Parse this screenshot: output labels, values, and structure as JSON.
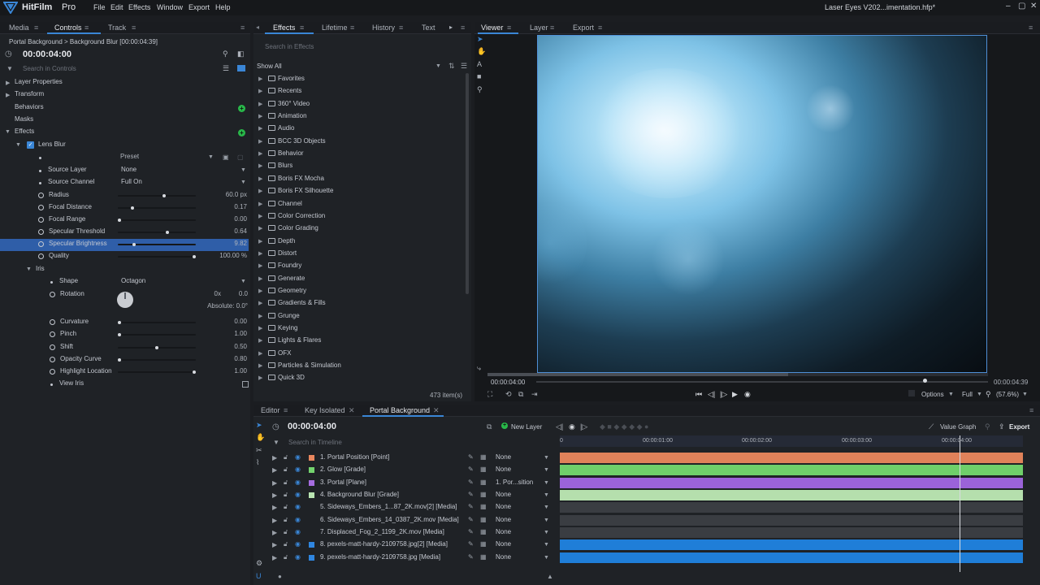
{
  "app": {
    "name": "HitFilm",
    "edition": "Pro",
    "window_title": "Laser Eyes V202...imentation.hfp*"
  },
  "menu": [
    "File",
    "Edit",
    "Effects",
    "Window",
    "Export",
    "Help"
  ],
  "left_tabs": [
    "Media",
    "Controls",
    "Track"
  ],
  "controls": {
    "breadcrumb": "Portal Background > Background Blur [00:00:04:39]",
    "time": "00:00:04:00",
    "search_placeholder": "Search in Controls",
    "sections": [
      "Layer Properties",
      "Transform",
      "Behaviors",
      "Masks",
      "Effects"
    ],
    "effect_name": "Lens Blur",
    "preset_label": "Preset",
    "source_layer": {
      "label": "Source Layer",
      "value": "None"
    },
    "source_channel": {
      "label": "Source Channel",
      "value": "Full On"
    },
    "params": [
      {
        "label": "Radius",
        "value": "60.0 px",
        "pos": 0.6
      },
      {
        "label": "Focal Distance",
        "value": "0.17",
        "pos": 0.17
      },
      {
        "label": "Focal Range",
        "value": "0.00",
        "pos": 0.0
      },
      {
        "label": "Specular Threshold",
        "value": "0.64",
        "pos": 0.64
      },
      {
        "label": "Specular Brightness",
        "value": "9.82",
        "pos": 0.2
      },
      {
        "label": "Quality",
        "value": "100.00 %",
        "pos": 1.0
      }
    ],
    "iris": {
      "label": "Iris",
      "shape": {
        "label": "Shape",
        "value": "Octagon"
      },
      "rotation": {
        "label": "Rotation",
        "turns": "0x",
        "deg": "0.0",
        "absolute": "Absolute: 0.0°"
      },
      "params": [
        {
          "label": "Curvature",
          "value": "0.00",
          "pos": 0.0
        },
        {
          "label": "Pinch",
          "value": "1.00",
          "pos": 0.0
        },
        {
          "label": "Shift",
          "value": "0.50",
          "pos": 0.5
        },
        {
          "label": "Opacity Curve",
          "value": "0.80",
          "pos": 0.0
        },
        {
          "label": "Highlight Location",
          "value": "1.00",
          "pos": 1.0
        }
      ],
      "view_iris": "View Iris"
    }
  },
  "effects_panel": {
    "tabs": [
      "Effects",
      "Lifetime",
      "History",
      "Text"
    ],
    "search_placeholder": "Search in Effects",
    "filter": "Show All",
    "folders": [
      "Favorites",
      "Recents",
      "360° Video",
      "Animation",
      "Audio",
      "BCC 3D Objects",
      "Behavior",
      "Blurs",
      "Boris FX Mocha",
      "Boris FX Silhouette",
      "Channel",
      "Color Correction",
      "Color Grading",
      "Depth",
      "Distort",
      "Foundry",
      "Generate",
      "Geometry",
      "Gradients & Fills",
      "Grunge",
      "Keying",
      "Lights & Flares",
      "OFX",
      "Particles & Simulation",
      "Quick 3D"
    ],
    "count": "473 item(s)"
  },
  "viewer": {
    "tabs": [
      "Viewer",
      "Layer",
      "Export"
    ],
    "time_start": "00:00:04:00",
    "time_end": "00:00:04:39",
    "progress": 0.6,
    "options_label": "Options",
    "quality": "Full",
    "zoom": "(57.6%)"
  },
  "timeline": {
    "tabs": [
      "Editor",
      "Key Isolated",
      "Portal Background"
    ],
    "time": "00:00:04:00",
    "new_layer": "New Layer",
    "value_graph": "Value Graph",
    "export": "Export",
    "search_placeholder": "Search in Timeline",
    "ruler": [
      "0",
      "00:00:01:00",
      "00:00:02:00",
      "00:00:03:00",
      "00:00:04:00"
    ],
    "playhead": 0.864,
    "layers": [
      {
        "name": "1. Portal Position [Point]",
        "parent": "None",
        "color": "#e9875e",
        "bar": "#e0825a"
      },
      {
        "name": "2. Glow [Grade]",
        "parent": "None",
        "color": "#74d36e",
        "bar": "#6fcf6a"
      },
      {
        "name": "3. Portal [Plane]",
        "parent": "1. Por...sition",
        "color": "#a66de0",
        "bar": "#9b63d9"
      },
      {
        "name": "4. Background Blur [Grade]",
        "parent": "None",
        "color": "#b9e4b1",
        "bar": "#b5dfad"
      },
      {
        "name": "5. Sideways_Embers_1...87_2K.mov[2] [Media]",
        "parent": "None",
        "color": "",
        "bar": "#3a3d42"
      },
      {
        "name": "6. Sideways_Embers_14_0387_2K.mov [Media]",
        "parent": "None",
        "color": "",
        "bar": "#3a3d42"
      },
      {
        "name": "7. Displaced_Fog_2_1199_2K.mov [Media]",
        "parent": "None",
        "color": "",
        "bar": "#3a3d42"
      },
      {
        "name": "8. pexels-matt-hardy-2109758.jpg[2] [Media]",
        "parent": "None",
        "color": "#2f86e0",
        "bar": "#1f7ed8"
      },
      {
        "name": "9. pexels-matt-hardy-2109758.jpg [Media]",
        "parent": "None",
        "color": "#2f86e0",
        "bar": "#1f7ed8"
      }
    ]
  }
}
